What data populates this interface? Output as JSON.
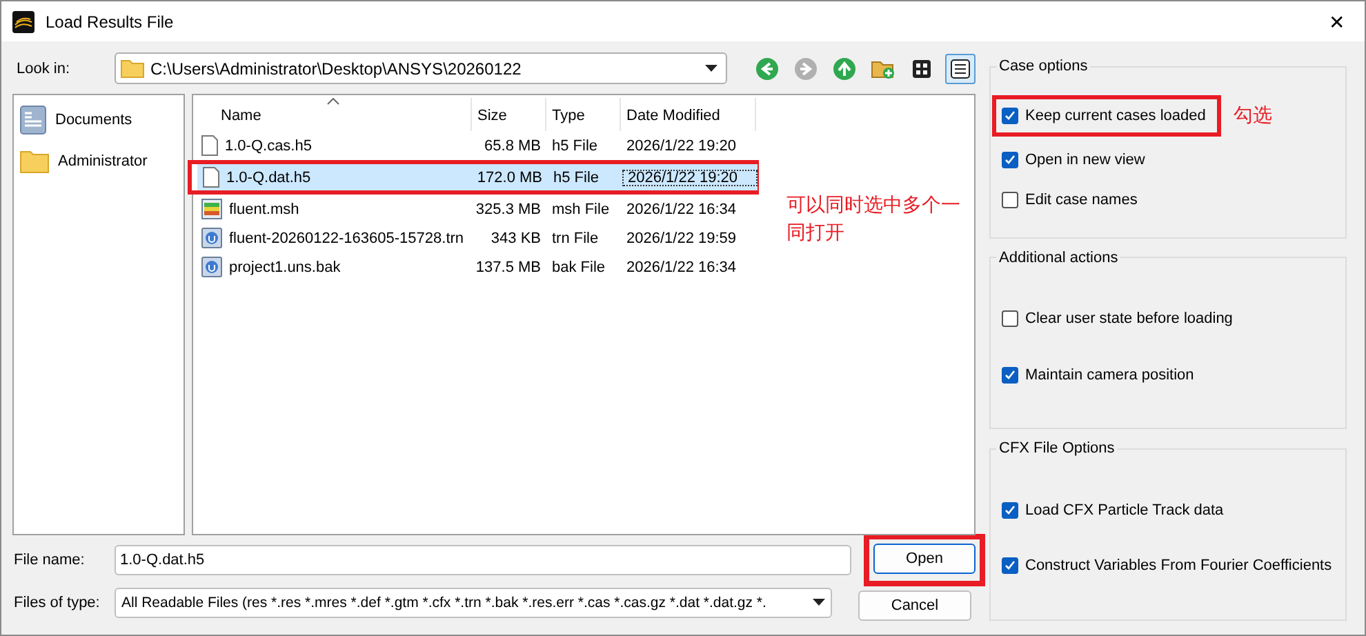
{
  "window": {
    "title": "Load Results File",
    "close": "✕"
  },
  "look_in": {
    "label": "Look in:",
    "path": "C:\\Users\\Administrator\\Desktop\\ANSYS\\20260122"
  },
  "nav_buttons": [
    {
      "kind": "back",
      "disabled": false
    },
    {
      "kind": "forward",
      "disabled": true
    },
    {
      "kind": "up",
      "disabled": false
    },
    {
      "kind": "new-folder",
      "disabled": false
    }
  ],
  "view_buttons": [
    {
      "kind": "icons",
      "selected": false
    },
    {
      "kind": "details",
      "selected": true
    }
  ],
  "sidebar": {
    "items": [
      {
        "label": "Documents",
        "kind": "documents"
      },
      {
        "label": "Administrator",
        "kind": "folder"
      }
    ]
  },
  "table": {
    "columns": [
      {
        "label": "Name",
        "sorted": true
      },
      {
        "label": "Size",
        "sorted": false
      },
      {
        "label": "Type",
        "sorted": false
      },
      {
        "label": "Date Modified",
        "sorted": false
      }
    ],
    "rows": [
      {
        "name": "1.0-Q.cas.h5",
        "size": "65.8 MB",
        "type": "h5 File",
        "date": "2026/1/22 19:20",
        "kind": "document",
        "selected": false,
        "highlighted": false
      },
      {
        "name": "1.0-Q.dat.h5",
        "size": "172.0 MB",
        "type": "h5 File",
        "date": "2026/1/22 19:20",
        "kind": "document",
        "selected": true,
        "highlighted": true,
        "note": "可以同时选中多个一同打开"
      },
      {
        "name": "fluent.msh",
        "size": "325.3 MB",
        "type": "msh File",
        "date": "2026/1/22 16:34",
        "kind": "mesh",
        "selected": false,
        "highlighted": false
      },
      {
        "name": "fluent-20260122-163605-15728.trn",
        "size": "343 KB",
        "type": "trn File",
        "date": "2026/1/22 19:59",
        "kind": "app",
        "selected": false,
        "highlighted": false
      },
      {
        "name": "project1.uns.bak",
        "size": "137.5 MB",
        "type": "bak File",
        "date": "2026/1/22 16:34",
        "kind": "app",
        "selected": false,
        "highlighted": false
      }
    ]
  },
  "file_name": {
    "label": "File name:",
    "value": "1.0-Q.dat.h5"
  },
  "file_type": {
    "label": "Files of type:",
    "value": "All Readable Files (res *.res *.mres *.def *.gtm *.cfx *.trn *.bak *.res.err *.cas *.cas.gz *.dat *.dat.gz *."
  },
  "buttons": [
    {
      "label": "Open",
      "default": true,
      "highlighted": true
    },
    {
      "label": "Cancel",
      "default": false,
      "highlighted": false
    }
  ],
  "groups": [
    {
      "title": "Case options",
      "options": [
        {
          "label": "Keep current cases loaded",
          "checked": true,
          "highlighted": true,
          "note": "勾选"
        },
        {
          "label": "Open in new view",
          "checked": true,
          "highlighted": false
        },
        {
          "label": "Edit case names",
          "checked": false,
          "highlighted": false
        }
      ]
    },
    {
      "title": "Additional actions",
      "options": [
        {
          "label": "Clear user state before loading",
          "checked": false,
          "highlighted": false
        },
        {
          "label": "Maintain camera position",
          "checked": true,
          "highlighted": false
        }
      ]
    },
    {
      "title": "CFX File Options",
      "options": [
        {
          "label": "Load CFX Particle Track data",
          "checked": true,
          "highlighted": false
        },
        {
          "label": "Construct Variables From Fourier Coefficients",
          "checked": true,
          "highlighted": false
        }
      ]
    }
  ]
}
